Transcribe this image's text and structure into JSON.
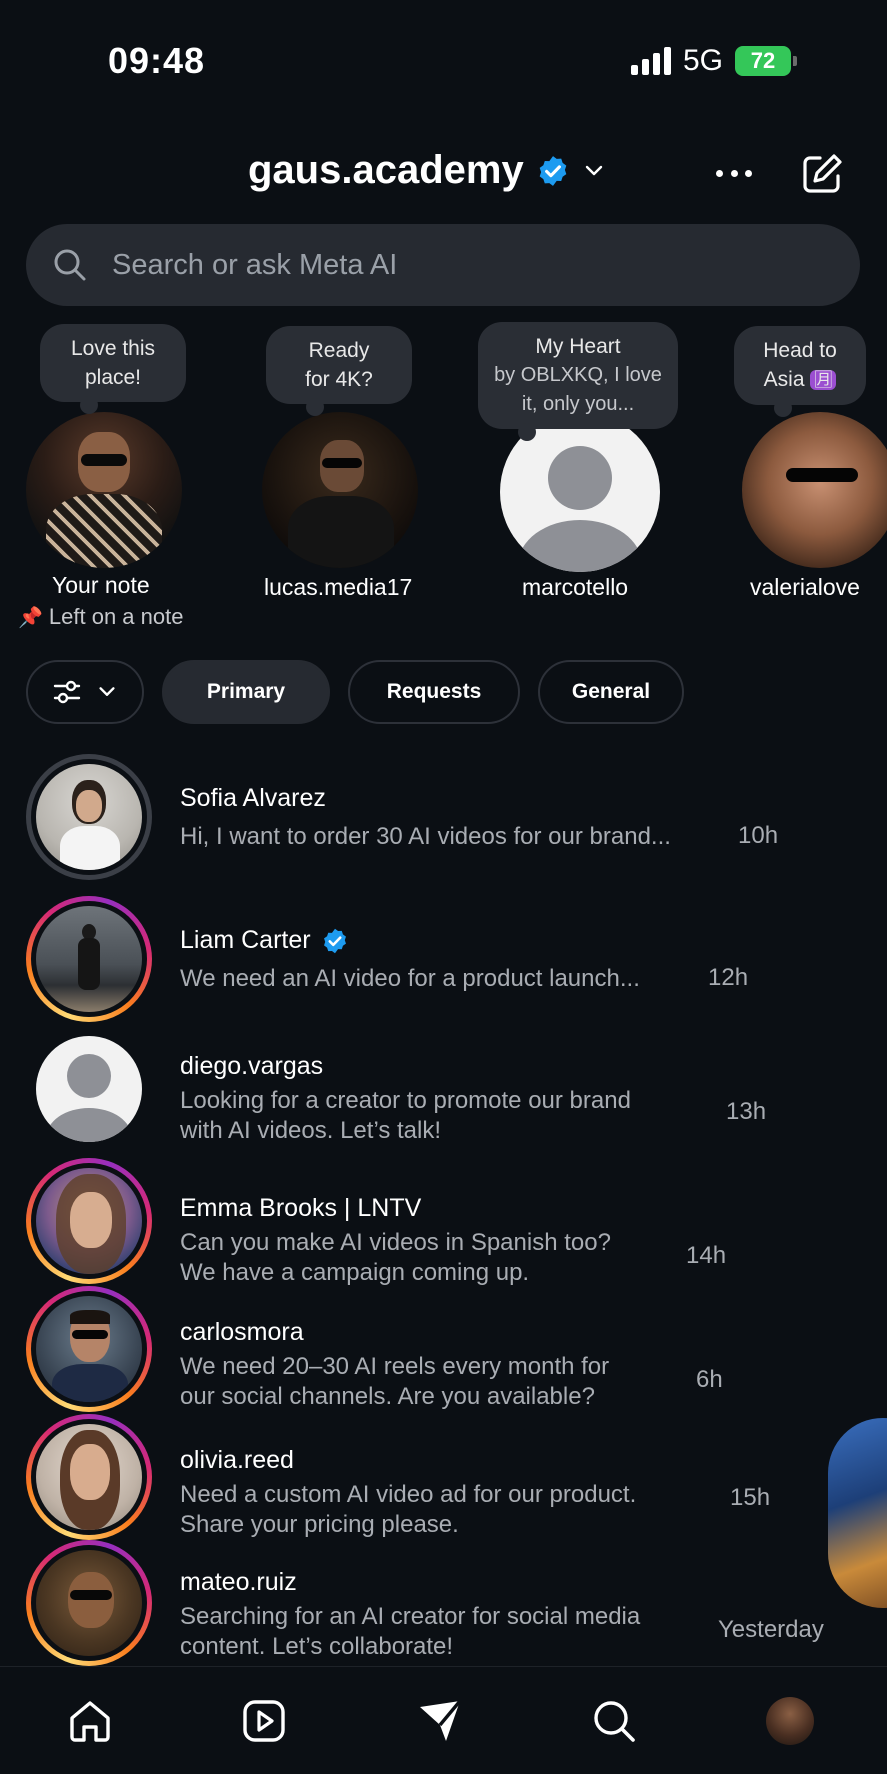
{
  "status_bar": {
    "time": "09:48",
    "network": "5G",
    "battery": "72"
  },
  "header": {
    "username": "gaus.academy"
  },
  "search": {
    "placeholder": "Search or ask Meta AI"
  },
  "notes": [
    {
      "bubble_line1": "Love this",
      "bubble_line2": "place!",
      "label": "Your note",
      "sublabel": "Left on a note"
    },
    {
      "bubble_line1": "Ready",
      "bubble_line2": "for 4K?",
      "label": "lucas.media17"
    },
    {
      "bubble_line1": "My Heart",
      "bubble_line2": "by OBLXKQ, I love",
      "bubble_line3": "it, only you...",
      "label": "marcotello"
    },
    {
      "bubble_line1": "Head to",
      "bubble_line2": "Asia",
      "bubble_emoji": "🈷",
      "label": "valerialove"
    }
  ],
  "filters": {
    "primary": "Primary",
    "requests": "Requests",
    "general": "General"
  },
  "conversations": [
    {
      "name": "Sofia Alvarez",
      "line1": "Hi, I want to order 30 AI videos for our brand...",
      "line2": "",
      "time": "10h"
    },
    {
      "name": "Liam Carter",
      "line1": "We need an AI video for a product launch...",
      "line2": "",
      "time": "12h"
    },
    {
      "name": "diego.vargas",
      "line1": "Looking for a creator to promote our brand",
      "line2": "with AI videos. Let’s talk!",
      "time": "13h"
    },
    {
      "name": "Emma Brooks | LNTV",
      "line1": "Can you make AI videos in Spanish too?",
      "line2": "We have a campaign coming up.",
      "time": "14h"
    },
    {
      "name": "carlosmora",
      "line1": "We need 20–30 AI reels every month for",
      "line2": "our social channels. Are you available?",
      "time": "6h"
    },
    {
      "name": "olivia.reed",
      "line1": "Need a custom AI video ad for our product.",
      "line2": "Share your pricing please.",
      "time": "15h"
    },
    {
      "name": "mateo.ruiz",
      "line1": "Searching for an AI creator for social media",
      "line2": "content. Let’s collaborate!",
      "time": "Yesterday"
    }
  ],
  "colors": {
    "background": "#0b0f14",
    "verified": "#1d9bf0",
    "battery": "#34c759",
    "chip_active": "#262a31"
  },
  "icons": [
    "search-icon",
    "verified-badge-icon",
    "chevron-down-icon",
    "more-icon",
    "compose-icon",
    "filter-icon",
    "home-icon",
    "reels-icon",
    "direct-icon",
    "explore-icon",
    "profile-avatar"
  ]
}
